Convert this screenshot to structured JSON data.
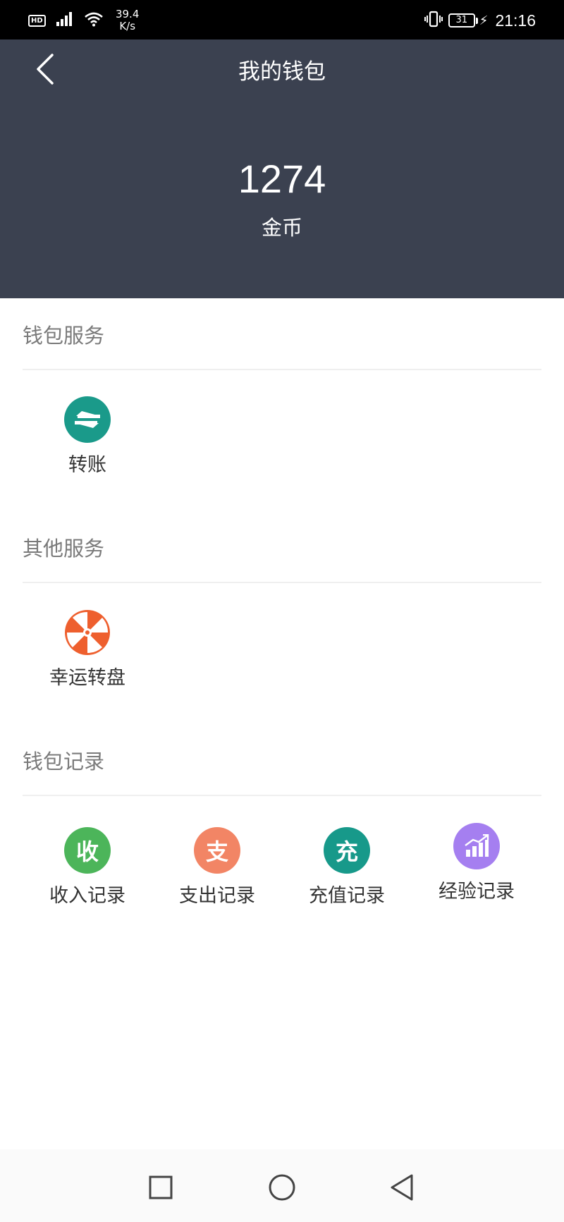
{
  "status_bar": {
    "hd_label": "HD",
    "net_speed_value": "39.4",
    "net_speed_unit": "K/s",
    "battery_level": "31",
    "time": "21:16"
  },
  "header": {
    "title": "我的钱包",
    "balance": "1274",
    "balance_unit": "金币"
  },
  "sections": {
    "wallet_services": {
      "title": "钱包服务",
      "items": [
        {
          "label": "转账",
          "icon": "transfer-icon",
          "color": "#1a9a8a"
        }
      ]
    },
    "other_services": {
      "title": "其他服务",
      "items": [
        {
          "label": "幸运转盘",
          "icon": "lucky-wheel-icon",
          "color": "#ee5f2e"
        }
      ]
    },
    "wallet_records": {
      "title": "钱包记录",
      "items": [
        {
          "label": "收入记录",
          "glyph": "收",
          "icon": "income-icon",
          "color": "#4cb55a"
        },
        {
          "label": "支出记录",
          "glyph": "支",
          "icon": "expense-icon",
          "color": "#f28565"
        },
        {
          "label": "充值记录",
          "glyph": "充",
          "icon": "recharge-icon",
          "color": "#17998a"
        },
        {
          "label": "经验记录",
          "icon": "experience-chart-icon",
          "color": "#a57ff0"
        }
      ]
    }
  },
  "nav_bar": {
    "buttons": [
      "recent-apps-icon",
      "home-icon",
      "back-icon"
    ]
  }
}
